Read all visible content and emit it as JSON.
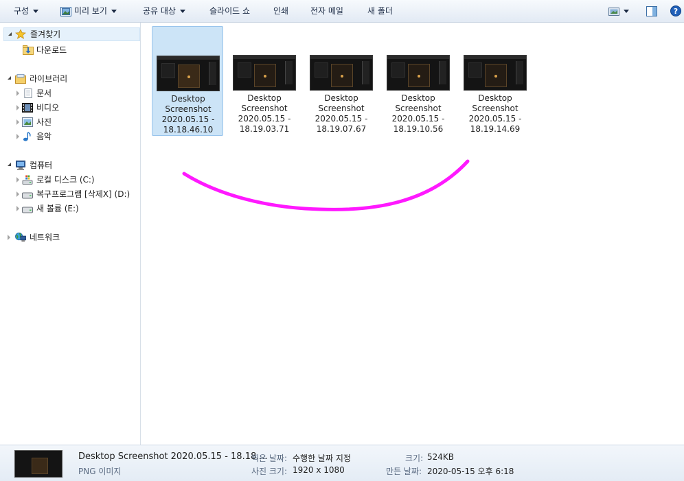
{
  "toolbar": {
    "organize": "구성",
    "preview": "미리 보기",
    "share": "공유 대상",
    "slideshow": "슬라이드 쇼",
    "print": "인쇄",
    "email": "전자 메일",
    "new_folder": "새 폴더"
  },
  "nav": {
    "favorites": "즐겨찾기",
    "downloads": "다운로드",
    "libraries": "라이브러리",
    "documents": "문서",
    "videos": "비디오",
    "pictures": "사진",
    "music": "음악",
    "computer": "컴퓨터",
    "drive_c": "로컬 디스크 (C:)",
    "drive_d": "복구프로그램 [삭제X] (D:)",
    "drive_e": "새 볼륨 (E:)",
    "network": "네트워크"
  },
  "files": [
    {
      "name": "Desktop\nScreenshot\n2020.05.15 -\n18.18.46.10",
      "selected": true
    },
    {
      "name": "Desktop\nScreenshot\n2020.05.15 -\n18.19.03.71",
      "selected": false
    },
    {
      "name": "Desktop\nScreenshot\n2020.05.15 -\n18.19.07.67",
      "selected": false
    },
    {
      "name": "Desktop\nScreenshot\n2020.05.15 -\n18.19.10.56",
      "selected": false
    },
    {
      "name": "Desktop\nScreenshot\n2020.05.15 -\n18.19.14.69",
      "selected": false
    }
  ],
  "details": {
    "filename": "Desktop Screenshot 2020.05.15 - 18.18....",
    "filetype": "PNG 이미지",
    "date_taken_label": "찍은 날짜:",
    "date_taken_value": "수행한 날짜 지정",
    "dimensions_label": "사진 크기:",
    "dimensions_value": "1920 x 1080",
    "size_label": "크기:",
    "size_value": "524KB",
    "created_label": "만든 날짜:",
    "created_value": "2020-05-15 오후 6:18"
  },
  "colors": {
    "annotation_stroke": "#ff00ff",
    "selection_bg": "#cce4f7"
  }
}
